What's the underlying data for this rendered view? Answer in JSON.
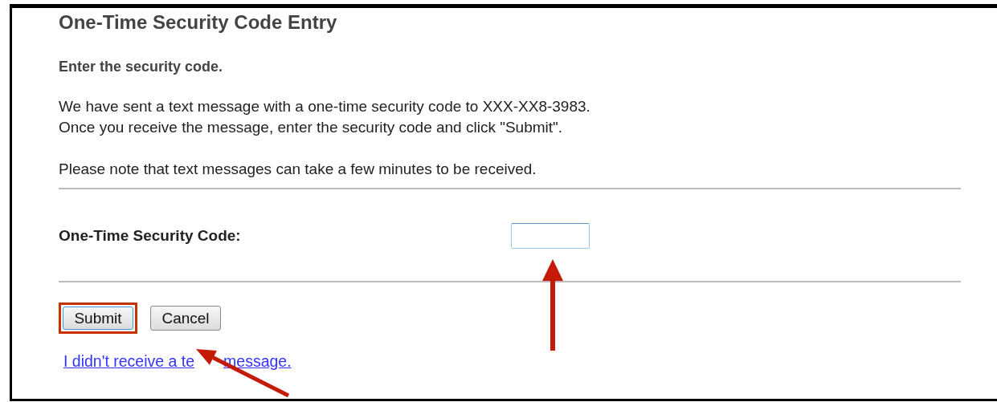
{
  "title": "One-Time Security Code Entry",
  "subtitle": "Enter the security code.",
  "message_lines": [
    "We have sent a text message with a one-time security code to XXX-XX8-3983.",
    "Once you receive the message, enter the security code and click \"Submit\"."
  ],
  "note": "Please note that text messages can take a few minutes to be received.",
  "field": {
    "label": "One-Time Security Code:"
  },
  "buttons": [
    {
      "label": "Submit",
      "highlighted": true
    },
    {
      "label": "Cancel",
      "highlighted": false
    }
  ],
  "link_parts": [
    "I didn't receive a te",
    "message."
  ],
  "annotations": [
    {
      "kind": "up-arrow"
    },
    {
      "kind": "diagonal-arrow"
    }
  ]
}
